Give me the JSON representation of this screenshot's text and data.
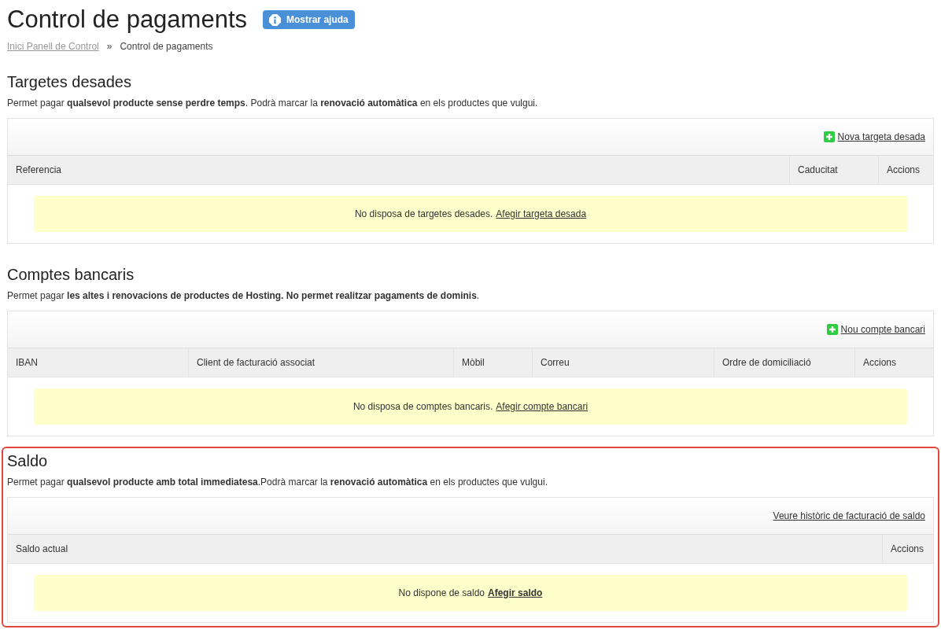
{
  "page_title": "Control de pagaments",
  "help_button": {
    "label": "Mostrar ajuda"
  },
  "breadcrumb": [
    {
      "label": "Inici Panell de Control",
      "link": true
    },
    {
      "label": "»",
      "link": false
    },
    {
      "label": "Control de pagaments",
      "link": false
    }
  ],
  "sections": [
    {
      "title": "Targetes desades",
      "description": "Permet pagar **qualsevol producte sense perdre temps**. Podrà marcar la **renovació automàtica** en els productes que vulgui.",
      "highlighted": false,
      "toolbar_link": {
        "label": "Nova targeta desada",
        "add_icon": true
      },
      "columns": [
        "Referencia",
        "Caducitat",
        "Accions"
      ],
      "empty_message": "No disposa de targetes desades.",
      "empty_link": {
        "label": "Afegir targeta desada",
        "bold": false
      }
    },
    {
      "title": "Comptes bancaris",
      "description": "Permet pagar **les altes i renovacions de productes de Hosting. No permet realitzar pagaments de dominis**.",
      "highlighted": false,
      "toolbar_link": {
        "label": "Nou compte bancari",
        "add_icon": true
      },
      "columns": [
        "IBAN",
        "Client de facturació associat",
        "Mòbil",
        "Correu",
        "Ordre de domiciliació",
        "Accions"
      ],
      "empty_message": "No disposa de comptes bancaris.",
      "empty_link": {
        "label": "Afegir compte bancari",
        "bold": false
      }
    },
    {
      "title": "Saldo",
      "description": "Permet pagar **qualsevol producte amb total immediatesa**.Podrà marcar la **renovació automàtica** en els productes que vulgui.",
      "highlighted": true,
      "toolbar_link": {
        "label": "Veure històric de facturació de saldo",
        "add_icon": false
      },
      "columns": [
        "Saldo actual",
        "Accions"
      ],
      "empty_message": "No dispone de saldo",
      "empty_link": {
        "label": "Afegir saldo",
        "bold": true
      }
    }
  ]
}
